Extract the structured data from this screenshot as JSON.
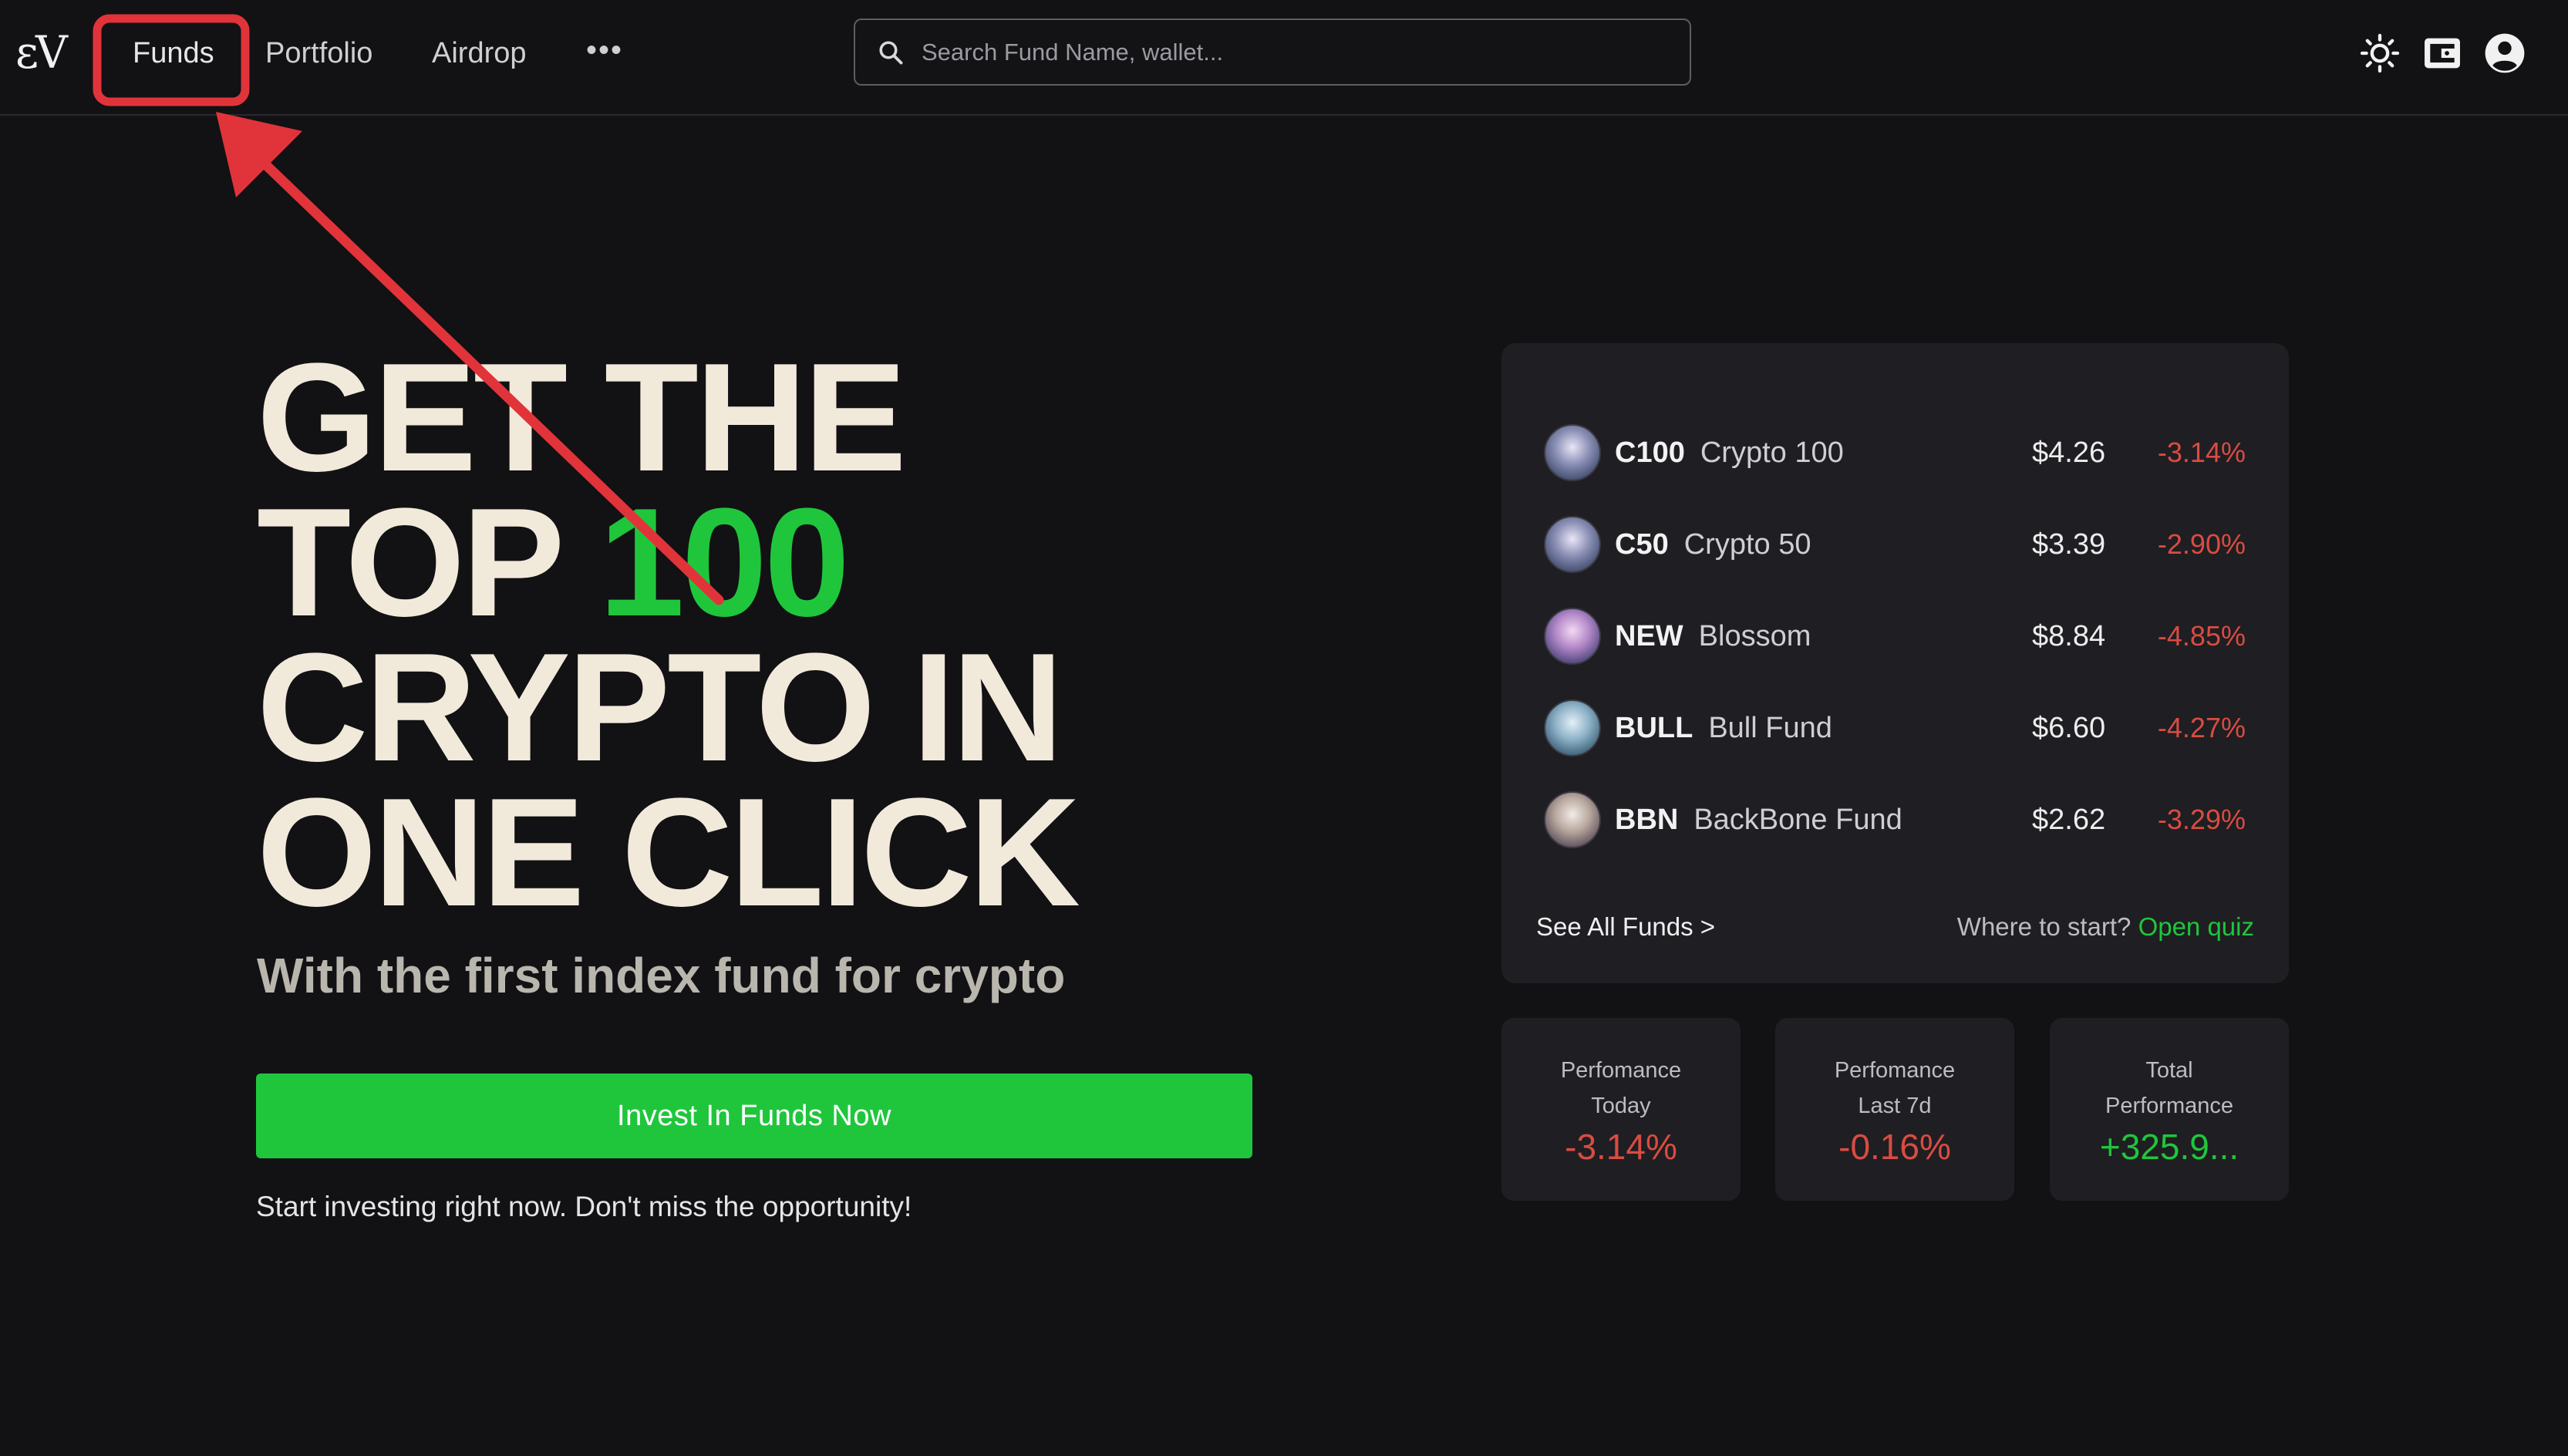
{
  "nav": {
    "logo": "εV",
    "items": [
      "Funds",
      "Portfolio",
      "Airdrop"
    ],
    "more_label": "•••"
  },
  "search": {
    "placeholder": "Search Fund Name, wallet..."
  },
  "icons": {
    "theme": "sun-icon",
    "wallet": "wallet-icon",
    "account": "account-icon"
  },
  "hero": {
    "title_line1": "GET THE",
    "title_line2_pre": "TOP ",
    "title_line2_accent": "100",
    "title_line3": "CRYPTO IN",
    "title_line4": "ONE CLICK",
    "subtitle": "With the first index fund for crypto",
    "cta_label": "Invest In Funds Now",
    "note": "Start investing right now. Don't miss the opportunity!"
  },
  "funds": {
    "rows": [
      {
        "ticker": "C100",
        "name": "Crypto 100",
        "price": "$4.26",
        "change": "-3.14%"
      },
      {
        "ticker": "C50",
        "name": "Crypto 50",
        "price": "$3.39",
        "change": "-2.90%"
      },
      {
        "ticker": "NEW",
        "name": "Blossom",
        "price": "$8.84",
        "change": "-4.85%"
      },
      {
        "ticker": "BULL",
        "name": "Bull Fund",
        "price": "$6.60",
        "change": "-4.27%"
      },
      {
        "ticker": "BBN",
        "name": "BackBone Fund",
        "price": "$2.62",
        "change": "-3.29%"
      }
    ],
    "see_all": "See All Funds >",
    "quiz_prompt": "Where to start?",
    "quiz_link": "Open quiz"
  },
  "stats": [
    {
      "label1": "Perfomance",
      "label2": "Today",
      "value": "-3.14%"
    },
    {
      "label1": "Perfomance",
      "label2": "Last 7d",
      "value": "-0.16%"
    },
    {
      "label1": "Total",
      "label2": "Performance",
      "value": "+325.9..."
    }
  ],
  "colors": {
    "background": "#121114",
    "accent_green": "#1fc63c",
    "negative_red": "#d94c42",
    "annotation_red": "#e0343a"
  }
}
